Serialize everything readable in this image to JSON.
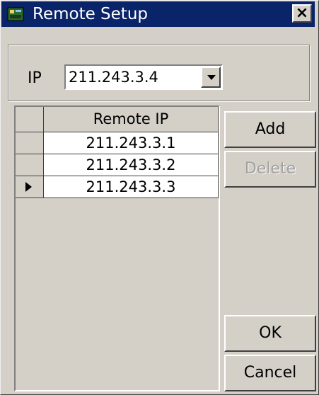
{
  "window": {
    "title": "Remote Setup",
    "close_label": "×"
  },
  "ip": {
    "label": "IP",
    "value": "211.243.3.4"
  },
  "grid": {
    "column_header": "Remote IP",
    "rows": [
      "211.243.3.1",
      "211.243.3.2",
      "211.243.3.3"
    ],
    "current_row_index": 2
  },
  "buttons": {
    "add": "Add",
    "delete": "Delete",
    "ok": "OK",
    "cancel": "Cancel"
  },
  "colors": {
    "titlebar": "#0a246a",
    "face": "#d4d0c8"
  }
}
